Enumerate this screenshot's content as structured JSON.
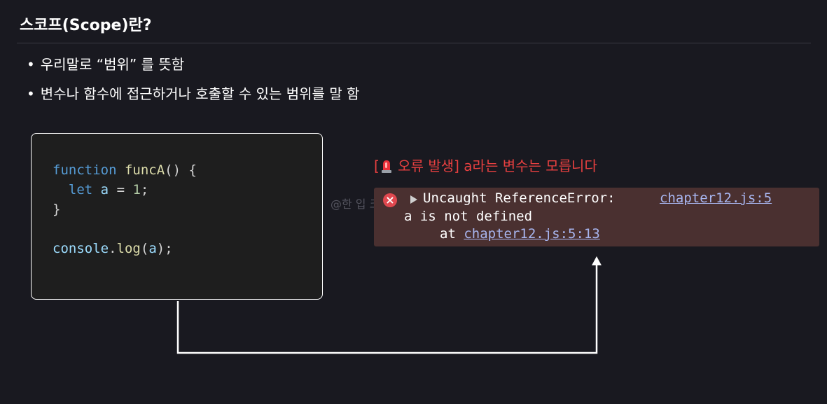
{
  "slide": {
    "title": "스코프(Scope)란?",
    "bullets": [
      "우리말로 “범위” 를 뜻함",
      "변수나 함수에 접근하거나 호출할 수 있는 범위를 말 함"
    ]
  },
  "code_block": {
    "line1_keyword": "function",
    "line1_name": "funcA",
    "line1_rest": "() {",
    "line2_keyword": "let",
    "line2_var": "a",
    "line2_op": " = ",
    "line2_num": "1",
    "line2_end": ";",
    "line3": "}",
    "line5_obj": "console",
    "line5_dot": ".",
    "line5_method": "log",
    "line5_open": "(",
    "line5_arg": "a",
    "line5_close": ");"
  },
  "error_annotation": {
    "open_bracket": "[",
    "siren_icon": "siren-icon",
    "text": " 오류 발생] a라는 변수는 모릅니다"
  },
  "watermark": "@한 입 크기로 잘라",
  "console_error": {
    "icon": "error-x-icon",
    "message_line1": "Uncaught ReferenceError:",
    "source_link": "chapter12.js:5",
    "message_line2": "a is not defined",
    "stack_prefix": "at ",
    "stack_link": "chapter12.js:5:13"
  },
  "colors": {
    "background": "#191920",
    "error_text": "#e84040",
    "console_bg": "#4a3030",
    "link": "#a8b6f0"
  }
}
